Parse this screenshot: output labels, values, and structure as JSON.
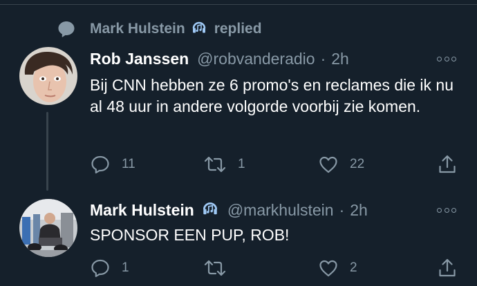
{
  "context": {
    "user_name": "Mark Hulstein",
    "action_text": "replied",
    "icons": [
      "speech-bubble-icon",
      "music-note-icon"
    ]
  },
  "tweets": [
    {
      "display_name": "Rob Janssen",
      "handle": "@robvanderadio",
      "separator": "·",
      "time": "2h",
      "text": "Bij CNN hebben ze 6 promo's en reclames die ik nu al 48 uur in andere volgorde voorbij zie komen.",
      "has_music_icon": false,
      "replies": "11",
      "retweets": "1",
      "likes": "22"
    },
    {
      "display_name": "Mark Hulstein",
      "handle": "@markhulstein",
      "separator": "·",
      "time": "2h",
      "text": "SPONSOR EEN PUP, ROB!",
      "has_music_icon": true,
      "replies": "1",
      "retweets": "",
      "likes": "2"
    }
  ],
  "colors": {
    "background": "#15202b",
    "text_primary": "#ffffff",
    "text_secondary": "#8899a6",
    "divider": "#38444d",
    "music_icon": "#9fc9f5"
  }
}
